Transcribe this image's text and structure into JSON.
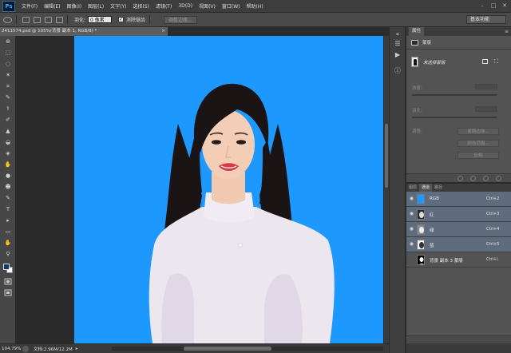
{
  "app": {
    "logo": "Ps"
  },
  "menu": [
    "文件(F)",
    "编辑(E)",
    "图像(I)",
    "图层(L)",
    "文字(Y)",
    "选择(S)",
    "滤镜(T)",
    "3D(D)",
    "视图(V)",
    "窗口(W)",
    "帮助(H)"
  ],
  "window_controls": {
    "minimize": "–",
    "maximize": "□",
    "close": "✕"
  },
  "options": {
    "feather_label": "羽化:",
    "feather_value": "0 像素",
    "antialias_label": "消除锯齿",
    "antialias_checked": true,
    "antialias_mark": "✓",
    "refine_edge": "调整边缘...",
    "workspace": "基本功能"
  },
  "document": {
    "tab_title": "2411574.psd @ 105%(背景 副本 1, RGB/8) *",
    "tab_close": "×"
  },
  "statusbar": {
    "zoom": "104.79%",
    "doc_info": "文档:2.96M/12.2M",
    "arrow": "▸"
  },
  "tools": {
    "glyphs": [
      "⊕",
      "⬚",
      "◌",
      "✶",
      "⌗",
      "✎",
      "⚕",
      "✐",
      "▲",
      "◒",
      "◈",
      "✋",
      "●",
      "☻",
      "✎",
      "T",
      "▸",
      "▭",
      "✋",
      "⚲"
    ]
  },
  "colors": {
    "canvas_background": "#1c98ff",
    "foreground": "#0d3a6a",
    "background": "#ffffff",
    "selected_channel": "#5f6c7e"
  },
  "properties": {
    "tab": "属性",
    "menu": "≡",
    "mask_label": "蒙版",
    "mask_name": "未选择蒙版",
    "density_label": "浓度:",
    "feather_label": "羽化:",
    "adjust_label": "调整:",
    "btn_mask_edge": "蒙版边缘...",
    "btn_color_range": "颜色范围...",
    "btn_invert": "反相"
  },
  "channels": {
    "tabs": [
      "图层",
      "通道",
      "路径"
    ],
    "active_tab": "通道",
    "rows": [
      {
        "name": "RGB",
        "key": "Ctrl+2"
      },
      {
        "name": "红",
        "key": "Ctrl+3"
      },
      {
        "name": "绿",
        "key": "Ctrl+4"
      },
      {
        "name": "蓝",
        "key": "Ctrl+5"
      },
      {
        "name": "背景 副本 3 蒙版",
        "key": "Ctrl+\\"
      }
    ]
  },
  "icons": [
    "move-tool-icon",
    "marquee-tool-icon",
    "lasso-tool-icon",
    "eye-icon",
    "mask-icon",
    "panel-menu-icon"
  ]
}
